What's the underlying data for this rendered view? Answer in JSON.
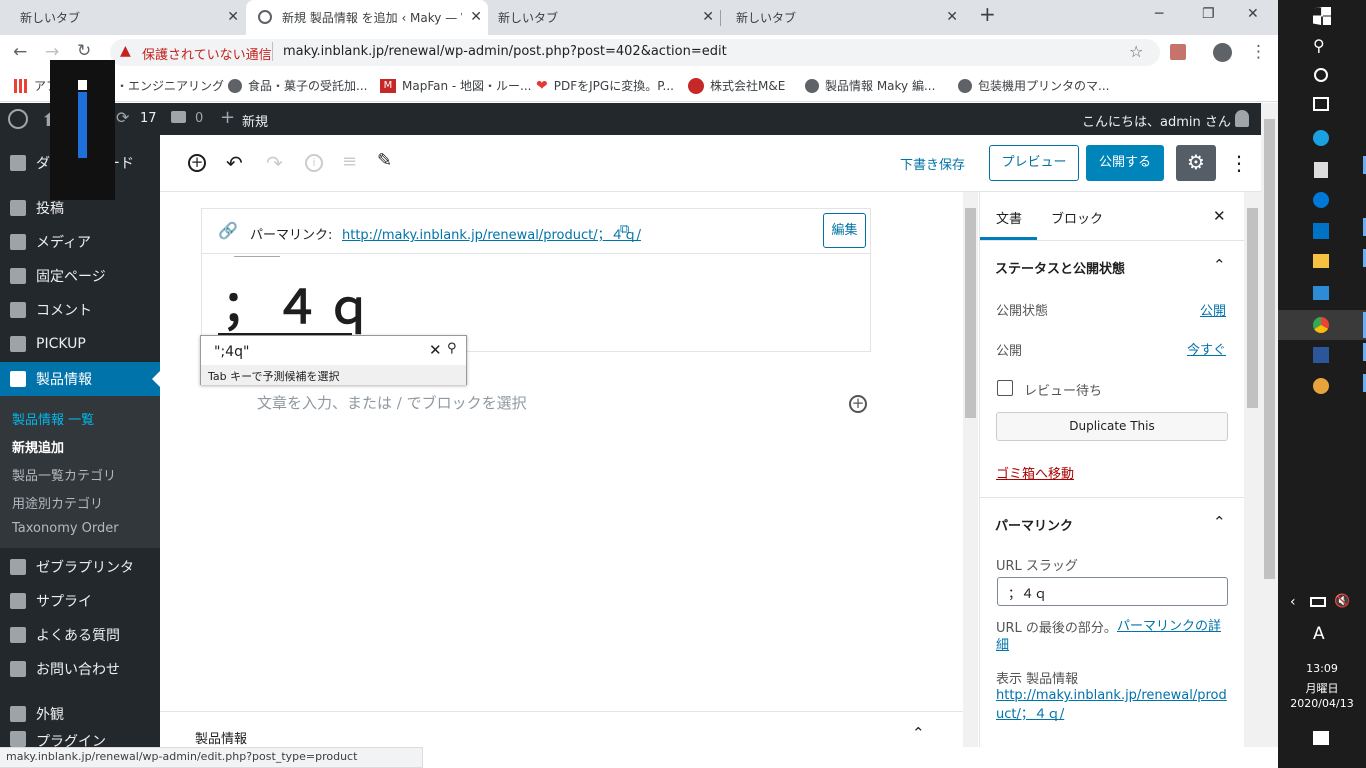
{
  "browser": {
    "tabs": [
      {
        "title": "新しいタブ"
      },
      {
        "title": "新規 製品情報 を追加 ‹ Maky — \\"
      },
      {
        "title": "新しいタブ"
      },
      {
        "title": "新しいタブ"
      }
    ],
    "security_label": "保護されていない通信",
    "url": "maky.inblank.jp/renewal/wp-admin/post.php?post=402&action=edit",
    "bookmarks": [
      {
        "label": "アプリ"
      },
      {
        "label": "キー・エンジニアリング"
      },
      {
        "label": "食品・菓子の受託加..."
      },
      {
        "label": "MapFan - 地図・ルー..."
      },
      {
        "label": "PDFをJPGに変換。P..."
      },
      {
        "label": "株式会社M&E"
      },
      {
        "label": "製品情報 Maky 編..."
      },
      {
        "label": "包装機用プリンタのマ..."
      }
    ],
    "status_url": "maky.inblank.jp/renewal/wp-admin/edit.php?post_type=product"
  },
  "adminbar": {
    "updates": "17",
    "comments": "0",
    "new_label": "新規",
    "greeting": "こんにちは、admin さん"
  },
  "sidebar": {
    "items": [
      {
        "label": "ダッシュボード"
      },
      {
        "label": "投稿"
      },
      {
        "label": "メディア"
      },
      {
        "label": "固定ページ"
      },
      {
        "label": "コメント"
      },
      {
        "label": "PICKUP"
      },
      {
        "label": "製品情報"
      },
      {
        "label": "ゼブラプリンタ"
      },
      {
        "label": "サプライ"
      },
      {
        "label": "よくある質問"
      },
      {
        "label": "お問い合わせ"
      },
      {
        "label": "外観"
      },
      {
        "label": "プラグイン"
      }
    ],
    "submenu": [
      {
        "label": "製品情報 一覧"
      },
      {
        "label": "新規追加"
      },
      {
        "label": "製品一覧カテゴリ"
      },
      {
        "label": "用途別カテゴリ"
      },
      {
        "label": "Taxonomy Order"
      }
    ]
  },
  "toolbar": {
    "save_draft": "下書き保存",
    "preview": "プレビュー",
    "publish": "公開する"
  },
  "editor": {
    "permalink_label": "パーマリンク:",
    "permalink_url": "http://maky.inblank.jp/renewal/product/；４ｑ/",
    "edit_button": "編集",
    "title": "；４ｑ",
    "ime_text": "\";4q\"",
    "ime_hint": "Tab キーで予測候補を選択",
    "placeholder": "文章を入力、または / でブロックを選択",
    "meta_box_title": "製品情報"
  },
  "panel": {
    "tabs": [
      "文書",
      "ブロック"
    ],
    "status_section": "ステータスと公開状態",
    "visibility_label": "公開状態",
    "visibility_value": "公開",
    "publish_label": "公開",
    "publish_value": "今すぐ",
    "pending_review": "レビュー待ち",
    "duplicate": "Duplicate This",
    "trash": "ゴミ箱へ移動",
    "permalink_section": "パーマリンク",
    "slug_label": "URL スラッグ",
    "slug_value": "；４ｑ",
    "url_help": "URL の最後の部分。",
    "url_help_link": "パーマリンクの詳細",
    "view_label": "表示 製品情報",
    "view_link": "http://maky.inblank.jp/renewal/product/；４ｑ/"
  },
  "taskbar": {
    "time": "13:09",
    "day": "月曜日",
    "date": "2020/04/13"
  },
  "colors": {
    "wp_admin": "#23282d",
    "wp_blue": "#0073aa",
    "accent": "#0085ba",
    "menu_active": "#0073aa",
    "taskbar": "#1c1c1c"
  }
}
